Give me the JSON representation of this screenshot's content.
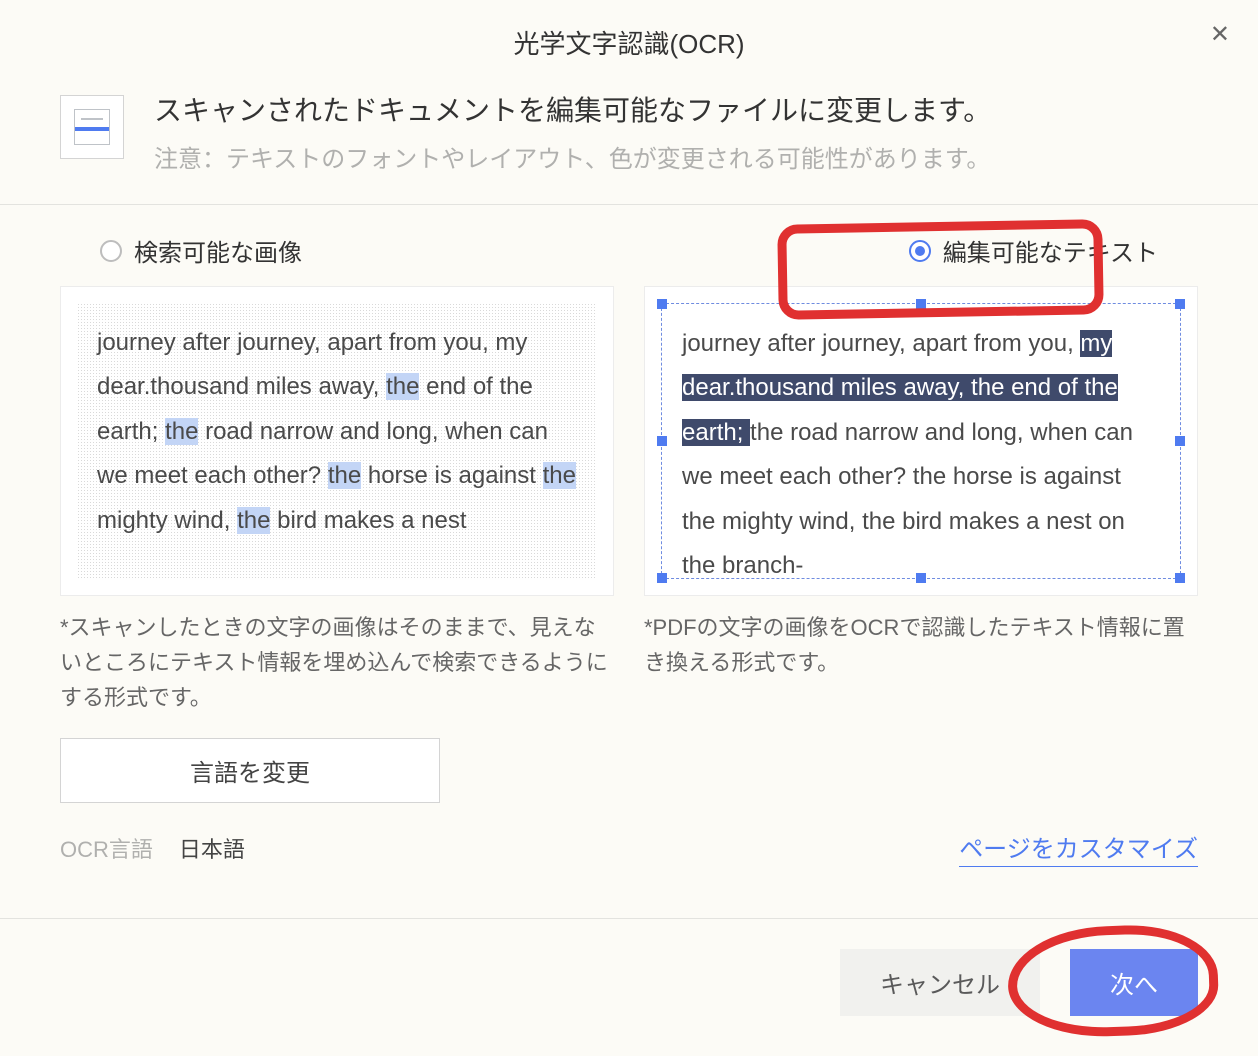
{
  "title": "光学文字認識(OCR)",
  "header": {
    "main": "スキャンされたドキュメントを編集可能なファイルに変更します。",
    "note": "注意：テキストのフォントやレイアウト、色が変更される可能性があります。"
  },
  "options": {
    "searchable_image": {
      "label": "検索可能な画像",
      "selected": false
    },
    "editable_text": {
      "label": "編集可能なテキスト",
      "selected": true
    }
  },
  "preview_left": {
    "t1": "journey after journey, apart from you, my dear.thousand miles away, ",
    "hl1": "the",
    "t2": " end of the earth; ",
    "hl2": "the",
    "t3": " road narrow and long, when can we meet each other? ",
    "hl3": "the",
    "t4": " horse is against ",
    "hl4": "the",
    "t5": " mighty wind, ",
    "hl5": "the",
    "t6": " bird makes a nest"
  },
  "preview_right": {
    "t1": "journey after journey, apart from you, ",
    "sel": "my dear.thousand miles away, the end of the earth; ",
    "t2": "the road narrow and long, when can we meet each other? the horse is against the mighty wind, the bird makes a nest on the branch-"
  },
  "captions": {
    "left": "*スキャンしたときの文字の画像はそのままで、見えないところにテキスト情報を埋め込んで検索できるようにする形式です。",
    "right": "*PDFの文字の画像をOCRで認識したテキスト情報に置き換える形式です。"
  },
  "lang_button": "言語を変更",
  "ocr_lang_label": "OCR言語",
  "ocr_lang_value": "日本語",
  "page_customize": "ページをカスタマイズ",
  "buttons": {
    "cancel": "キャンセル",
    "next": "次へ"
  }
}
